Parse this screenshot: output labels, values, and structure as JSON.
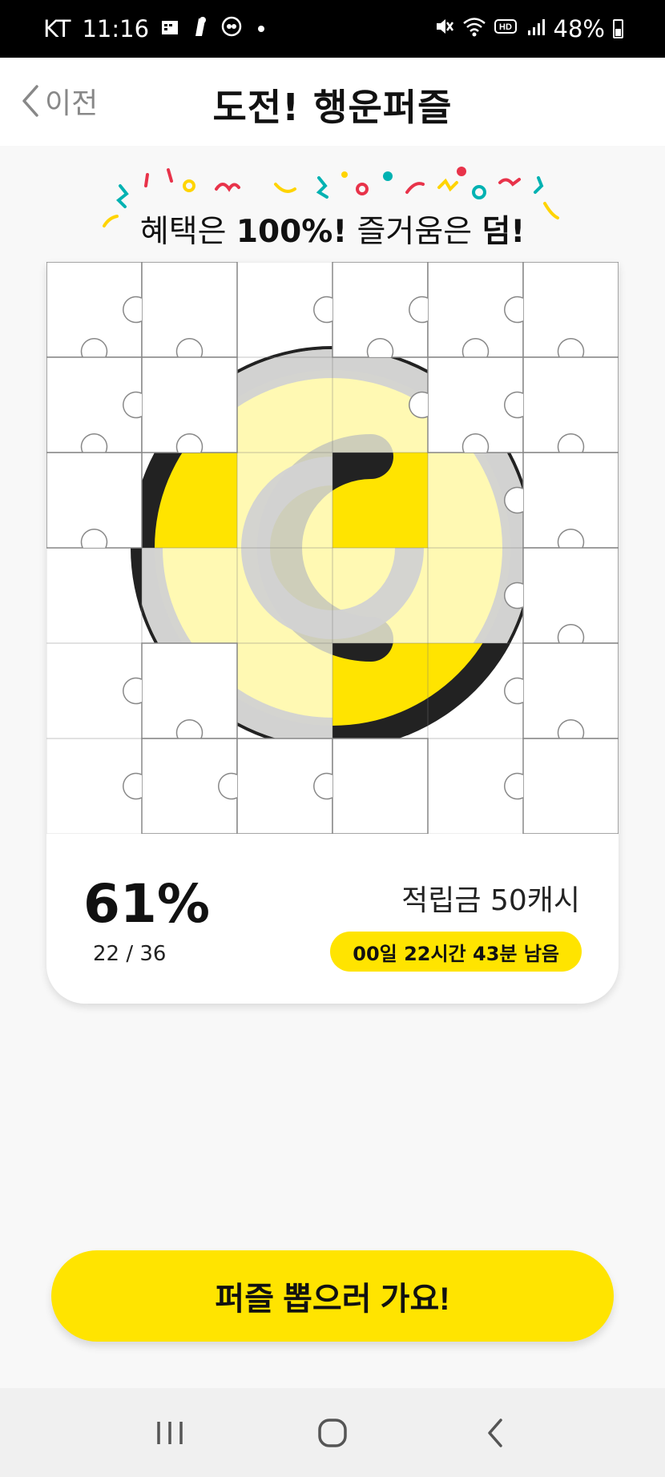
{
  "status_bar": {
    "carrier": "KT",
    "time": "11:16",
    "battery": "48%",
    "left_icons": [
      "calendar-icon",
      "mic-icon",
      "app-icon",
      "dot-icon"
    ],
    "right_icons": [
      "mute-icon",
      "wifi-icon",
      "hd-icon",
      "signal-icon",
      "battery-icon"
    ]
  },
  "header": {
    "back_label": "이전",
    "title": "도전! 행운퍼즐"
  },
  "banner": {
    "text_1": "혜택은 ",
    "text_2": "100%!",
    "text_3": " 즐거움은 ",
    "text_4": "덤!"
  },
  "puzzle": {
    "collected": 22,
    "total": 36,
    "accent_color": "#ffe400",
    "ring_color": "#222222",
    "logo_icon": "coin-c-icon"
  },
  "progress": {
    "percent_label": "61%",
    "count_label": "22 / 36",
    "value": 0.61
  },
  "reward": {
    "label": "적립금 50캐시",
    "timer": "00일 22시간 43분 남음"
  },
  "cta": {
    "label": "퍼즐 뽑으러 가요!"
  },
  "navbar": {
    "recent": "recent-apps-icon",
    "home": "home-icon",
    "back": "back-icon"
  }
}
